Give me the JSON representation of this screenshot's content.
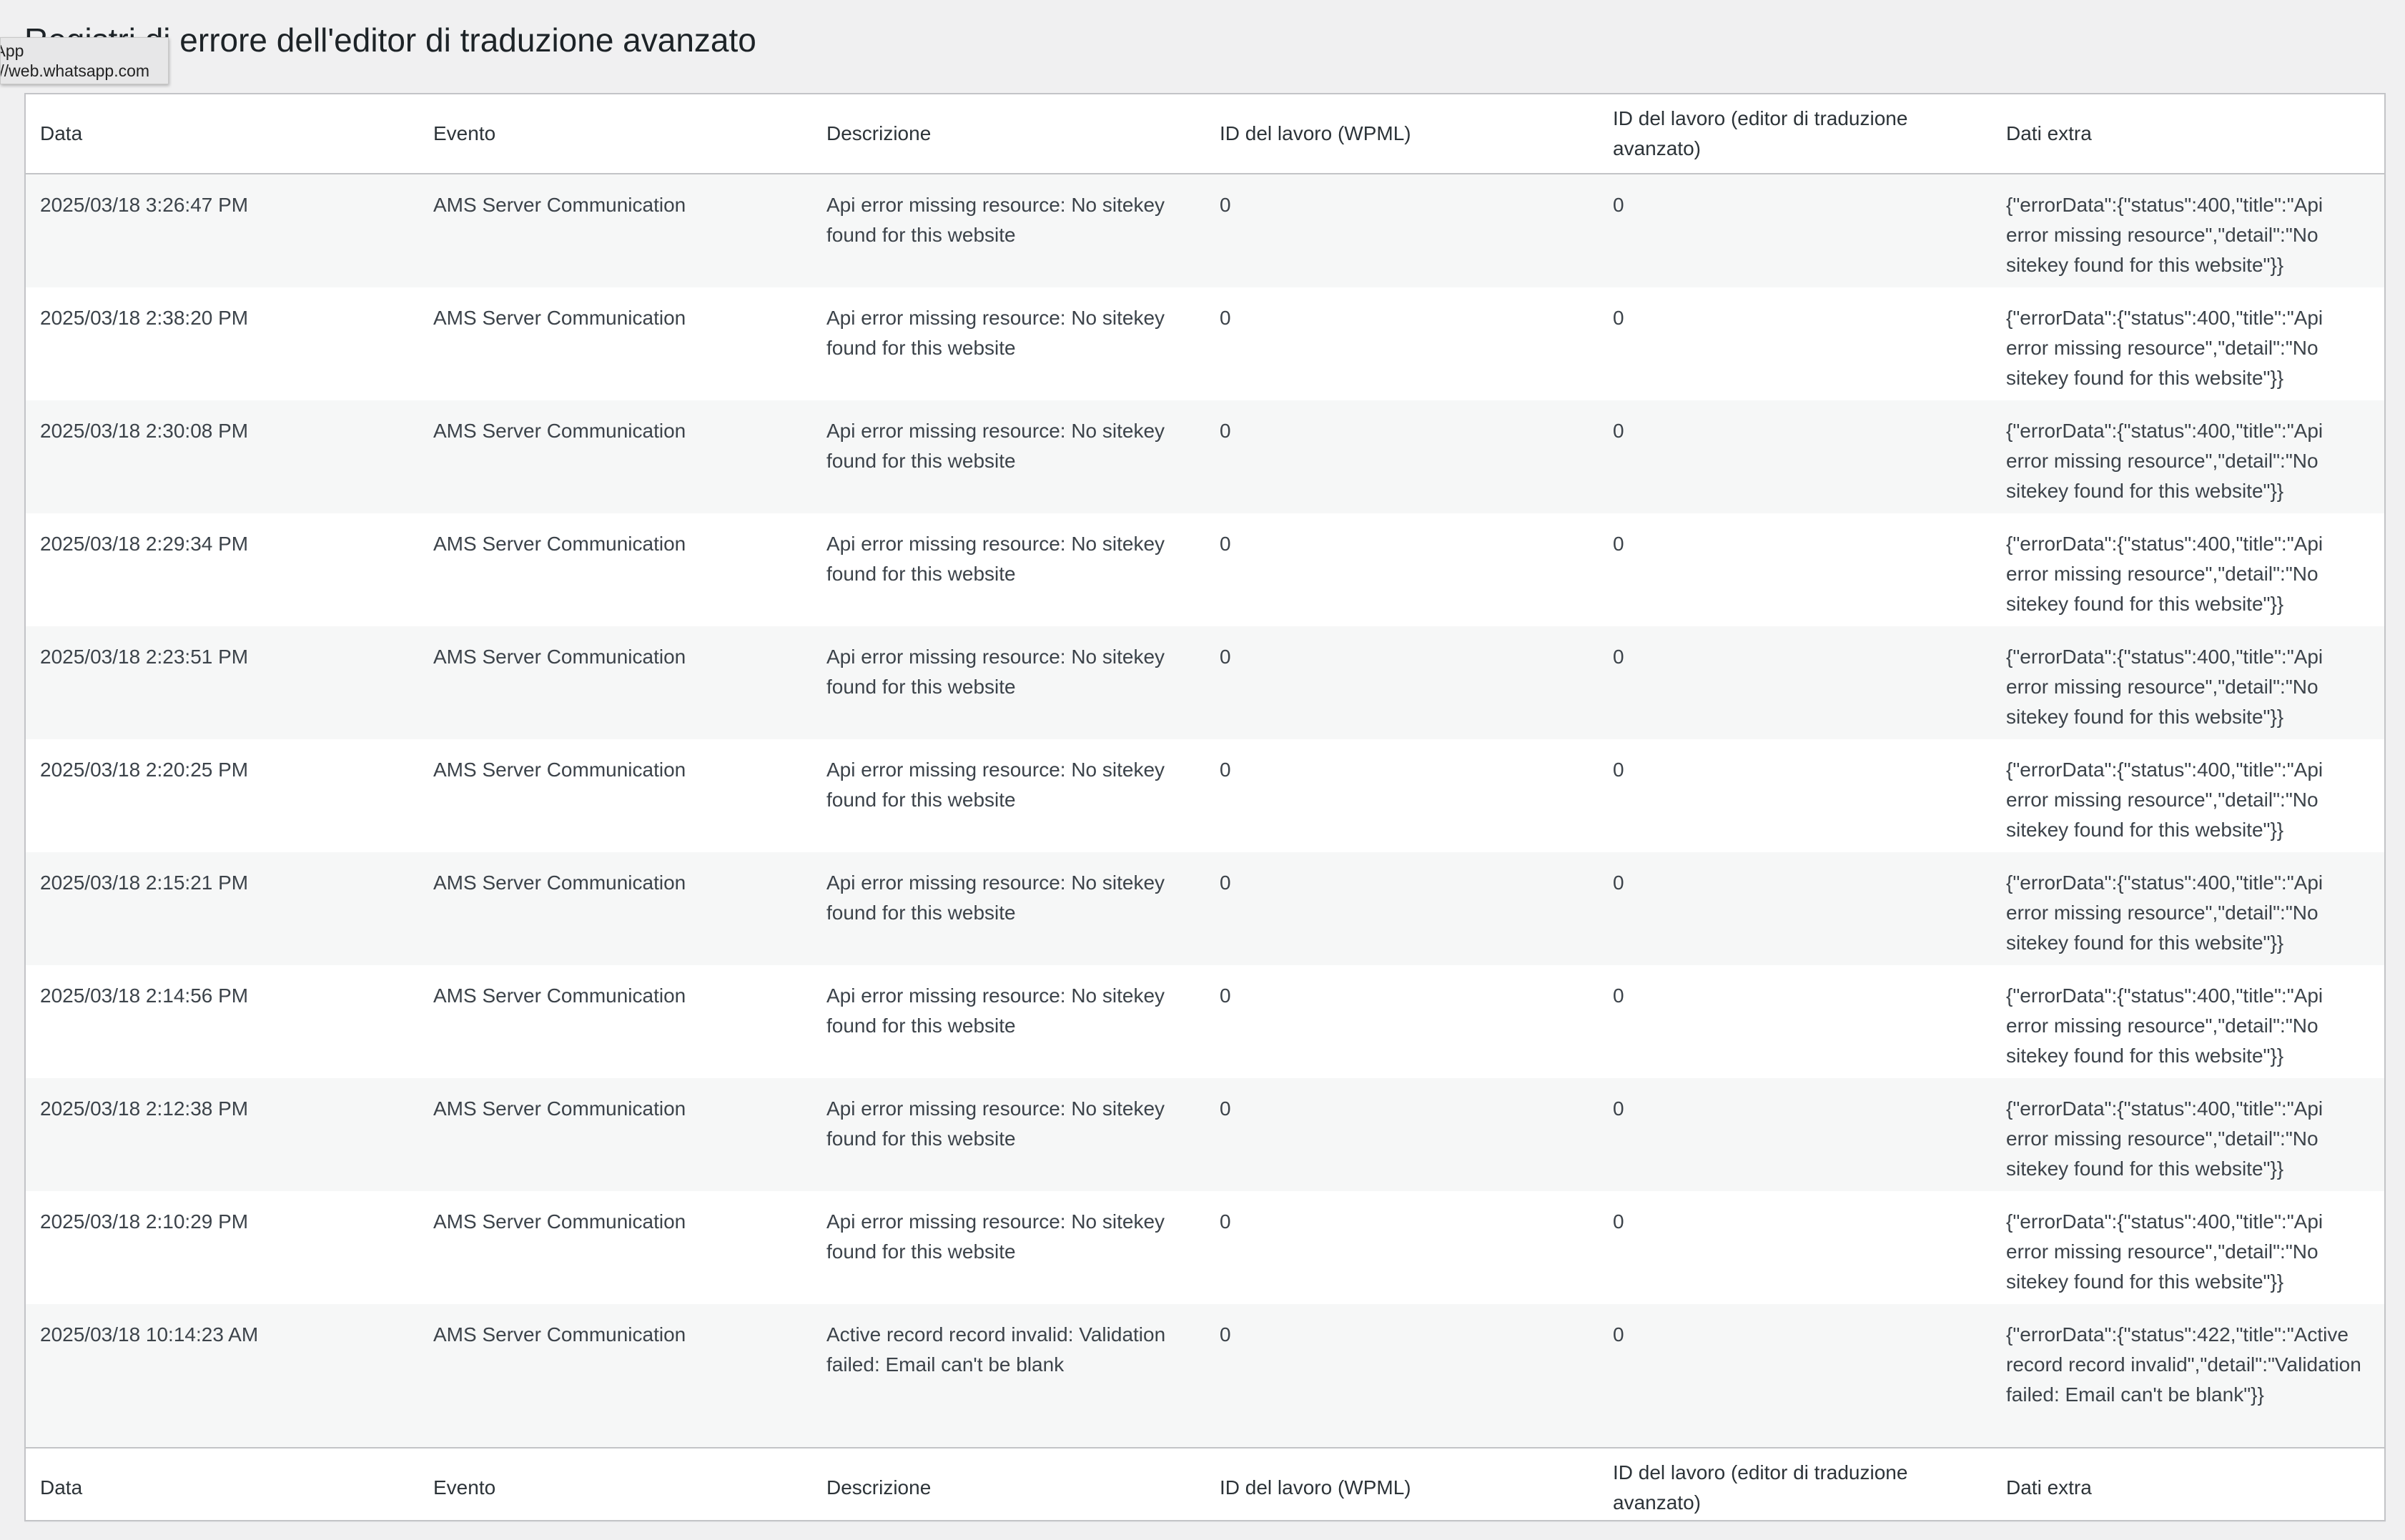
{
  "page": {
    "title": "Registri di errore dell'editor di traduzione avanzato"
  },
  "tooltip": {
    "title": "sApp",
    "url": "://web.whatsapp.com"
  },
  "table": {
    "columns": [
      "Data",
      "Evento",
      "Descrizione",
      "ID del lavoro (WPML)",
      "ID del lavoro (editor di traduzione avanzato)",
      "Dati extra"
    ],
    "rows": [
      [
        "2025/03/18 3:26:47 PM",
        "AMS Server Communication",
        "Api error missing resource: No sitekey found for this website",
        "0",
        "0",
        "{\"errorData\":{\"status\":400,\"title\":\"Api error missing resource\",\"detail\":\"No sitekey found for this website\"}}"
      ],
      [
        "2025/03/18 2:38:20 PM",
        "AMS Server Communication",
        "Api error missing resource: No sitekey found for this website",
        "0",
        "0",
        "{\"errorData\":{\"status\":400,\"title\":\"Api error missing resource\",\"detail\":\"No sitekey found for this website\"}}"
      ],
      [
        "2025/03/18 2:30:08 PM",
        "AMS Server Communication",
        "Api error missing resource: No sitekey found for this website",
        "0",
        "0",
        "{\"errorData\":{\"status\":400,\"title\":\"Api error missing resource\",\"detail\":\"No sitekey found for this website\"}}"
      ],
      [
        "2025/03/18 2:29:34 PM",
        "AMS Server Communication",
        "Api error missing resource: No sitekey found for this website",
        "0",
        "0",
        "{\"errorData\":{\"status\":400,\"title\":\"Api error missing resource\",\"detail\":\"No sitekey found for this website\"}}"
      ],
      [
        "2025/03/18 2:23:51 PM",
        "AMS Server Communication",
        "Api error missing resource: No sitekey found for this website",
        "0",
        "0",
        "{\"errorData\":{\"status\":400,\"title\":\"Api error missing resource\",\"detail\":\"No sitekey found for this website\"}}"
      ],
      [
        "2025/03/18 2:20:25 PM",
        "AMS Server Communication",
        "Api error missing resource: No sitekey found for this website",
        "0",
        "0",
        "{\"errorData\":{\"status\":400,\"title\":\"Api error missing resource\",\"detail\":\"No sitekey found for this website\"}}"
      ],
      [
        "2025/03/18 2:15:21 PM",
        "AMS Server Communication",
        "Api error missing resource: No sitekey found for this website",
        "0",
        "0",
        "{\"errorData\":{\"status\":400,\"title\":\"Api error missing resource\",\"detail\":\"No sitekey found for this website\"}}"
      ],
      [
        "2025/03/18 2:14:56 PM",
        "AMS Server Communication",
        "Api error missing resource: No sitekey found for this website",
        "0",
        "0",
        "{\"errorData\":{\"status\":400,\"title\":\"Api error missing resource\",\"detail\":\"No sitekey found for this website\"}}"
      ],
      [
        "2025/03/18 2:12:38 PM",
        "AMS Server Communication",
        "Api error missing resource: No sitekey found for this website",
        "0",
        "0",
        "{\"errorData\":{\"status\":400,\"title\":\"Api error missing resource\",\"detail\":\"No sitekey found for this website\"}}"
      ],
      [
        "2025/03/18 2:10:29 PM",
        "AMS Server Communication",
        "Api error missing resource: No sitekey found for this website",
        "0",
        "0",
        "{\"errorData\":{\"status\":400,\"title\":\"Api error missing resource\",\"detail\":\"No sitekey found for this website\"}}"
      ],
      [
        "2025/03/18 10:14:23 AM",
        "AMS Server Communication",
        "Active record record invalid: Validation failed: Email can't be blank",
        "0",
        "0",
        "{\"errorData\":{\"status\":422,\"title\":\"Active record record invalid\",\"detail\":\"Validation failed: Email can't be blank\"}}"
      ]
    ]
  }
}
